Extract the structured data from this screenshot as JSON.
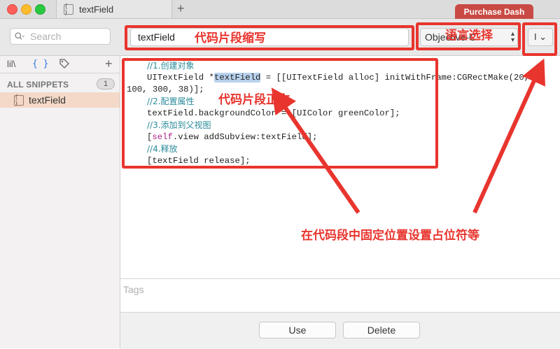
{
  "window": {
    "tab_title": "textField",
    "tab_icon": "{ }",
    "new_tab_label": "+",
    "purchase_label": "Purchase Dash"
  },
  "toolbar": {
    "search_placeholder": "Search",
    "abbreviation_value": "textField",
    "language_value": "Objective-C",
    "cursor_button_label": "I ⌄"
  },
  "sidebar": {
    "tabs": [
      {
        "icon": "library-icon",
        "label": "lil\\"
      },
      {
        "icon": "code-braces-icon",
        "label": "{ }"
      },
      {
        "icon": "tag-icon",
        "label": ""
      }
    ],
    "add_label": "+",
    "section_header": "ALL SNIPPETS",
    "snippet_count": "1",
    "snippets": [
      {
        "icon": "{ }",
        "label": "textField"
      }
    ]
  },
  "editor": {
    "lines": [
      {
        "comment": "//1.创建对象"
      },
      {
        "pre": "UITextField *",
        "highlight": "textField",
        "post": " = [[UITextField alloc] initWithFrame:CGRectMake(20,"
      },
      {
        "plain": "100, 300, 38)];"
      },
      {
        "comment": "//2.配置属性"
      },
      {
        "plain": "textField.backgroundColor = [UIColor greenColor];"
      },
      {
        "comment": "//3.添加到父视图"
      },
      {
        "keyword": "self",
        "post": ".view addSubview:textField];",
        "pre": "["
      },
      {
        "comment": "//4.释放"
      },
      {
        "plain": "[textField release];"
      }
    ]
  },
  "tags": {
    "placeholder": "Tags"
  },
  "actions": {
    "use_label": "Use",
    "delete_label": "Delete"
  },
  "annotations": {
    "abbreviation": "代码片段缩写",
    "language": "语言选择",
    "body": "代码片段正文",
    "placeholder_note": "在代码段中固定位置设置占位符等",
    "color": "#e8352e"
  }
}
